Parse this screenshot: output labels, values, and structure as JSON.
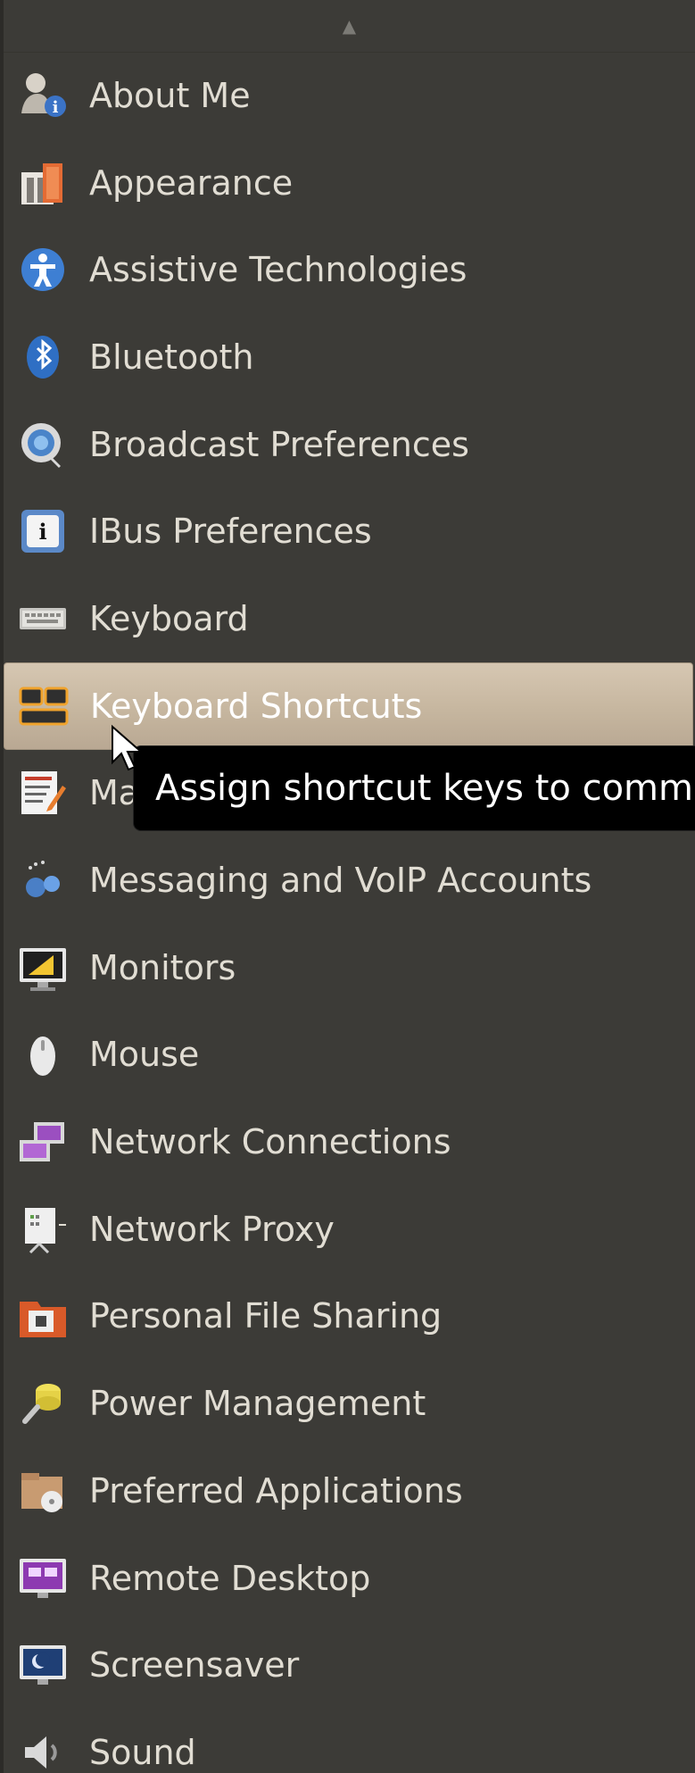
{
  "menu": {
    "scroll_up": "▲",
    "items": [
      {
        "label": "About Me",
        "icon": "user-info-icon"
      },
      {
        "label": "Appearance",
        "icon": "appearance-icon"
      },
      {
        "label": "Assistive Technologies",
        "icon": "accessibility-icon"
      },
      {
        "label": "Bluetooth",
        "icon": "bluetooth-icon"
      },
      {
        "label": "Broadcast Preferences",
        "icon": "broadcast-icon"
      },
      {
        "label": "IBus Preferences",
        "icon": "ibus-icon"
      },
      {
        "label": "Keyboard",
        "icon": "keyboard-icon"
      },
      {
        "label": "Keyboard Shortcuts",
        "icon": "keyboard-shortcuts-icon"
      },
      {
        "label": "Ma",
        "icon": "main-menu-icon"
      },
      {
        "label": "Messaging and VoIP Accounts",
        "icon": "messaging-icon"
      },
      {
        "label": "Monitors",
        "icon": "monitor-icon"
      },
      {
        "label": "Mouse",
        "icon": "mouse-icon"
      },
      {
        "label": "Network Connections",
        "icon": "network-connections-icon"
      },
      {
        "label": "Network Proxy",
        "icon": "network-proxy-icon"
      },
      {
        "label": "Personal File Sharing",
        "icon": "file-sharing-icon"
      },
      {
        "label": "Power Management",
        "icon": "power-icon"
      },
      {
        "label": "Preferred Applications",
        "icon": "preferred-apps-icon"
      },
      {
        "label": "Remote Desktop",
        "icon": "remote-desktop-icon"
      },
      {
        "label": "Screensaver",
        "icon": "screensaver-icon"
      },
      {
        "label": "Sound",
        "icon": "sound-icon"
      }
    ]
  },
  "tooltip": {
    "text": "Assign shortcut keys to comma"
  },
  "colors": {
    "menu_bg": "#3c3b37",
    "hover_bg": "#c9b9a3",
    "text": "#e1ddd3",
    "tooltip_bg": "#000000"
  }
}
